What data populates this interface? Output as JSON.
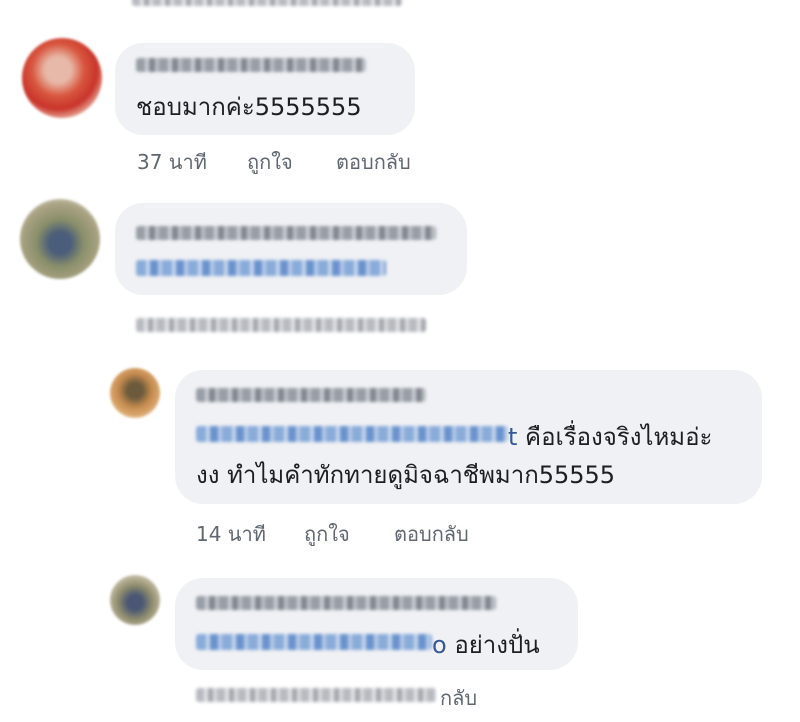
{
  "comments": [
    {
      "text": "ชอบมากค่ะ5555555",
      "meta": {
        "time": "37 นาที",
        "like": "ถูกใจ",
        "reply": "ตอบกลับ"
      }
    },
    {
      "reply_1": {
        "tag_tail": "t",
        "line1": " คือเรื่องจริงไหมอ่ะ",
        "line2": "งง ทำไมคำทักทายดูมิจฉาชีพมาก55555",
        "meta": {
          "time": "14 นาที",
          "like": "ถูกใจ",
          "reply": "ตอบกลับ"
        }
      },
      "reply_2": {
        "tag_tail": "o",
        "text": " อย่างปั่น",
        "meta_reply_tail": "กลับ"
      }
    }
  ],
  "colors": {
    "bubble": "#eff1f4",
    "link": "#365899",
    "meta": "#606770",
    "text": "#1c1e21"
  }
}
